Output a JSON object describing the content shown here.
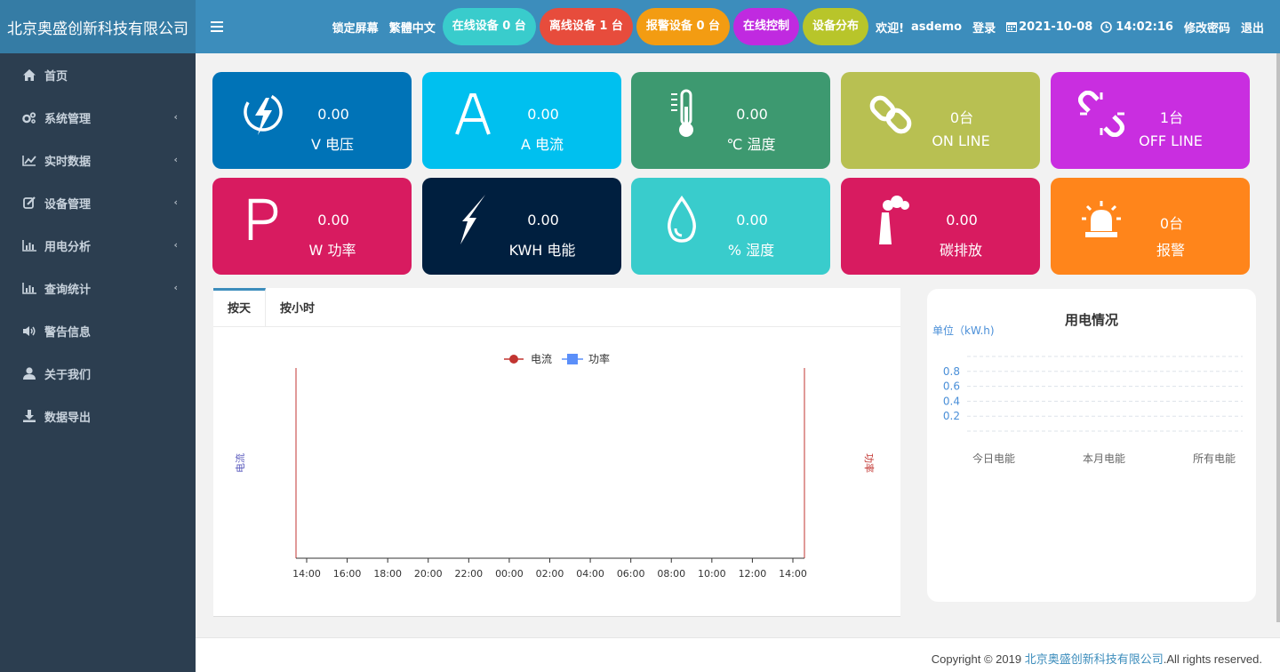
{
  "header": {
    "brand": "北京奥盛创新科技有限公司",
    "lock_screen": "锁定屏幕",
    "lang": "繁體中文",
    "pills": [
      {
        "label": "在线设备 0 台",
        "color": "#39cccc"
      },
      {
        "label": "离线设备 1 台",
        "color": "#e74c3c"
      },
      {
        "label": "报警设备 0 台",
        "color": "#f39c12"
      },
      {
        "label": "在线控制",
        "color": "#c02ae0"
      },
      {
        "label": "设备分布",
        "color": "#b8c52a"
      }
    ],
    "welcome": "欢迎!",
    "user": "asdemo",
    "login": "登录",
    "date": "2021-10-08",
    "time": "14:02:16",
    "change_pwd": "修改密码",
    "logout": "退出"
  },
  "sidebar": {
    "items": [
      {
        "label": "首页",
        "icon": "home-icon",
        "chev": ""
      },
      {
        "label": "系统管理",
        "icon": "cogs-icon",
        "chev": "‹"
      },
      {
        "label": "实时数据",
        "icon": "line-chart-icon",
        "chev": "‹"
      },
      {
        "label": "设备管理",
        "icon": "edit-icon",
        "chev": "‹"
      },
      {
        "label": "用电分析",
        "icon": "bar-chart-icon",
        "chev": "‹"
      },
      {
        "label": "查询统计",
        "icon": "bar-chart-icon",
        "chev": "‹"
      },
      {
        "label": "警告信息",
        "icon": "volume-icon",
        "chev": ""
      },
      {
        "label": "关于我们",
        "icon": "user-icon",
        "chev": ""
      },
      {
        "label": "数据导出",
        "icon": "download-icon",
        "chev": ""
      }
    ]
  },
  "cards": [
    {
      "value": "0.00",
      "label": "V 电压",
      "color": "#0073b7",
      "icon": "lightning-circle-icon"
    },
    {
      "value": "0.00",
      "label": "A 电流",
      "color": "#00c0ef",
      "icon": "letter-a-icon"
    },
    {
      "value": "0.00",
      "label": "℃ 温度",
      "color": "#3d9970",
      "icon": "thermometer-icon"
    },
    {
      "value": "0台",
      "label": "ON LINE",
      "color": "#b8c052",
      "icon": "link-icon"
    },
    {
      "value": "1台",
      "label": "OFF LINE",
      "color": "#c92ee0",
      "icon": "broken-link-icon"
    },
    {
      "value": "0.00",
      "label": "W 功率",
      "color": "#d81b60",
      "icon": "letter-p-icon"
    },
    {
      "value": "0.00",
      "label": "KWH 电能",
      "color": "#001f3f",
      "icon": "bolt-icon"
    },
    {
      "value": "0.00",
      "label": "% 湿度",
      "color": "#39cccc",
      "icon": "droplet-icon"
    },
    {
      "value": "0.00",
      "label": "碳排放",
      "color": "#d81b60",
      "icon": "factory-icon"
    },
    {
      "value": "0台",
      "label": "报警",
      "color": "#ff851b",
      "icon": "alarm-light-icon"
    }
  ],
  "tabs": [
    {
      "label": "按天"
    },
    {
      "label": "按小时"
    }
  ],
  "chart_data": [
    {
      "type": "line",
      "legend": [
        "电流",
        "功率"
      ],
      "series": [
        {
          "name": "电流",
          "values": [],
          "color": "#c23531"
        },
        {
          "name": "功率",
          "values": [],
          "color": "#5b8ff9"
        }
      ],
      "x": [
        "14:00",
        "16:00",
        "18:00",
        "20:00",
        "22:00",
        "00:00",
        "02:00",
        "04:00",
        "06:00",
        "08:00",
        "10:00",
        "12:00",
        "14:00"
      ],
      "ylabel_left": "电流",
      "ylabel_right": "功率",
      "legend_position": "top-center",
      "grid": false
    },
    {
      "type": "bar",
      "title": "用电情况",
      "unit_label": "单位（kW.h)",
      "categories": [
        "今日电能",
        "本月电能",
        "所有电能"
      ],
      "values": [],
      "yticks": [
        "0.8",
        "0.6",
        "0.4",
        "0.2"
      ],
      "ylim": [
        0,
        1
      ],
      "grid": true
    }
  ],
  "footer": {
    "prefix": "Copyright © 2019 ",
    "company": "北京奥盛创新科技有限公司",
    "suffix": ".All rights reserved."
  }
}
